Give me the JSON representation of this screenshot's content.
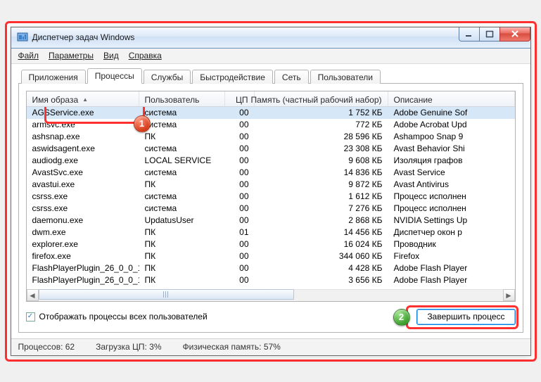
{
  "window": {
    "title": "Диспетчер задач Windows"
  },
  "menu": {
    "file": "Файл",
    "options": "Параметры",
    "view": "Вид",
    "help": "Справка"
  },
  "tabs": [
    "Приложения",
    "Процессы",
    "Службы",
    "Быстродействие",
    "Сеть",
    "Пользователи"
  ],
  "active_tab": 1,
  "columns": {
    "name": "Имя образа",
    "user": "Пользователь",
    "cpu": "ЦП",
    "mem": "Память (частный рабочий набор)",
    "desc": "Описание"
  },
  "rows": [
    {
      "name": "AGSService.exe",
      "user": "система",
      "cpu": "00",
      "mem": "1 752 КБ",
      "desc": "Adobe Genuine Sof",
      "sel": true
    },
    {
      "name": "armsvc.exe",
      "user": "система",
      "cpu": "00",
      "mem": "772 КБ",
      "desc": "Adobe Acrobat Upd"
    },
    {
      "name": "ashsnap.exe",
      "user": "ПК",
      "cpu": "00",
      "mem": "28 596 КБ",
      "desc": "Ashampoo Snap 9"
    },
    {
      "name": "aswidsagent.exe",
      "user": "система",
      "cpu": "00",
      "mem": "23 308 КБ",
      "desc": "Avast Behavior Shi"
    },
    {
      "name": "audiodg.exe",
      "user": "LOCAL SERVICE",
      "cpu": "00",
      "mem": "9 608 КБ",
      "desc": "Изоляция графов"
    },
    {
      "name": "AvastSvc.exe",
      "user": "система",
      "cpu": "00",
      "mem": "14 836 КБ",
      "desc": "Avast Service"
    },
    {
      "name": "avastui.exe",
      "user": "ПК",
      "cpu": "00",
      "mem": "9 872 КБ",
      "desc": "Avast Antivirus"
    },
    {
      "name": "csrss.exe",
      "user": "система",
      "cpu": "00",
      "mem": "1 612 КБ",
      "desc": "Процесс исполнен"
    },
    {
      "name": "csrss.exe",
      "user": "система",
      "cpu": "00",
      "mem": "7 276 КБ",
      "desc": "Процесс исполнен"
    },
    {
      "name": "daemonu.exe",
      "user": "UpdatusUser",
      "cpu": "00",
      "mem": "2 868 КБ",
      "desc": "NVIDIA Settings Up"
    },
    {
      "name": "dwm.exe",
      "user": "ПК",
      "cpu": "01",
      "mem": "14 456 КБ",
      "desc": "Диспетчер окон р"
    },
    {
      "name": "explorer.exe",
      "user": "ПК",
      "cpu": "00",
      "mem": "16 024 КБ",
      "desc": "Проводник"
    },
    {
      "name": "firefox.exe",
      "user": "ПК",
      "cpu": "00",
      "mem": "344 060 КБ",
      "desc": "Firefox"
    },
    {
      "name": "FlashPlayerPlugin_26_0_0_1...",
      "user": "ПК",
      "cpu": "00",
      "mem": "4 428 КБ",
      "desc": "Adobe Flash Player"
    },
    {
      "name": "FlashPlayerPlugin_26_0_0_1...",
      "user": "ПК",
      "cpu": "00",
      "mem": "3 656 КБ",
      "desc": "Adobe Flash Player"
    }
  ],
  "checkbox": {
    "label": "Отображать процессы всех пользователей",
    "checked": true
  },
  "button": {
    "end": "Завершить процесс"
  },
  "status": {
    "procs_label": "Процессов:",
    "procs": "62",
    "cpu_label": "Загрузка ЦП:",
    "cpu": "3%",
    "mem_label": "Физическая память:",
    "mem": "57%"
  }
}
